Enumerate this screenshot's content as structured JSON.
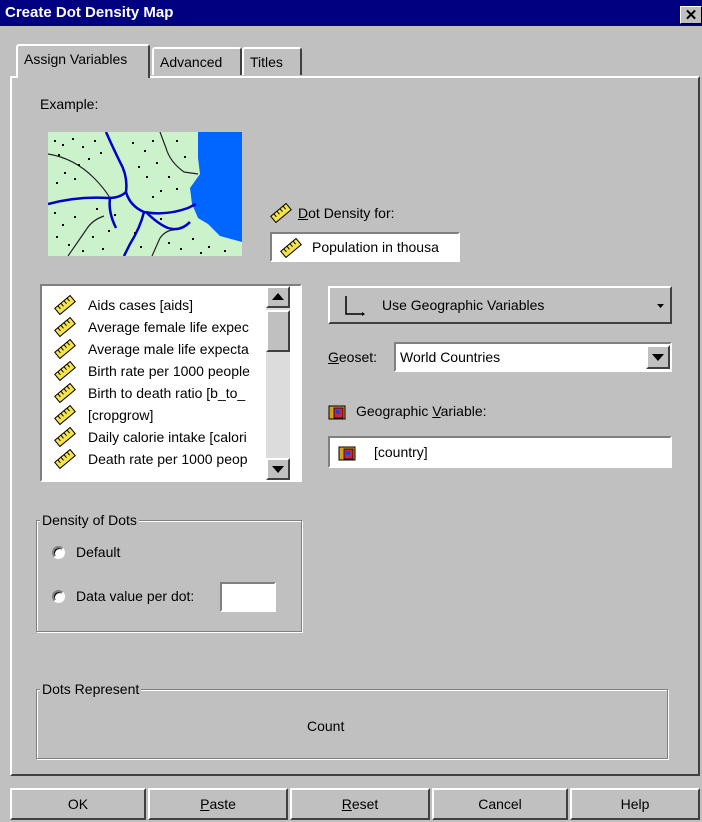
{
  "window": {
    "title": "Create Dot Density Map",
    "close_glyph": "✕"
  },
  "tabs": [
    {
      "label": "Assign Variables",
      "active": true
    },
    {
      "label": "Advanced",
      "active": false
    },
    {
      "label": "Titles",
      "active": false
    }
  ],
  "example": {
    "label": "Example:"
  },
  "dot_density": {
    "label_prefix": "D",
    "label_rest": "ot Density for:",
    "value": "Population in thousa"
  },
  "variables_list": {
    "items": [
      "Aids cases [aids]",
      "Average female life expec",
      "Average male life expecta",
      "Birth rate per 1000 people",
      "Birth to death ratio [b_to_",
      "[cropgrow]",
      "Daily calorie intake [calori",
      "Death rate per 1000 peop"
    ]
  },
  "geo_mode": {
    "label": "Use Geographic Variables"
  },
  "geoset": {
    "label_prefix": "G",
    "label_rest": "eoset:",
    "value": "World Countries"
  },
  "geographic_variable": {
    "label_head": "Geographic ",
    "label_u": "V",
    "label_tail": "ariable:",
    "value": "[country]"
  },
  "density_of_dots": {
    "title": "Density of Dots",
    "default_label": "Default",
    "data_value_label": "Data value per dot:",
    "data_value": ""
  },
  "dots_represent": {
    "title": "Dots Represent",
    "value": "Count"
  },
  "footer": {
    "ok": "OK",
    "paste_u": "P",
    "paste_rest": "aste",
    "reset_u": "R",
    "reset_rest": "eset",
    "cancel": "Cancel",
    "help": "Help"
  },
  "colors": {
    "titlebar": "#000080",
    "map_land": "#ccf2cc",
    "map_water": "#0066ff",
    "face": "#c0c0c0"
  },
  "icons": {
    "scale_variable": "ruler-icon",
    "geo_variable": "map-folder-icon",
    "geo_mode": "axis-icon"
  }
}
